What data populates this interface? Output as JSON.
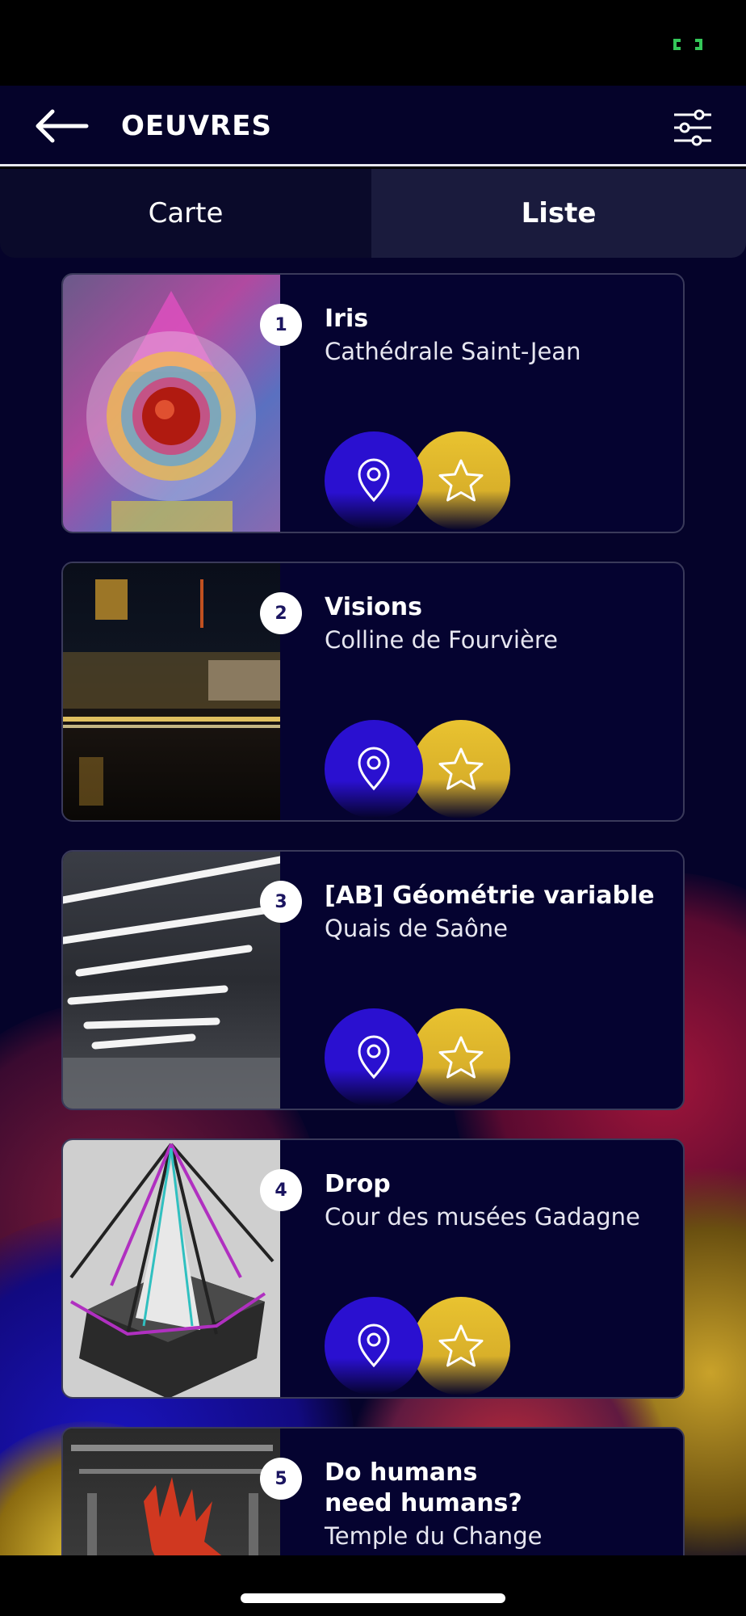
{
  "header": {
    "title": "OEUVRES"
  },
  "tabs": [
    {
      "label": "Carte",
      "active": false
    },
    {
      "label": "Liste",
      "active": true
    }
  ],
  "colors": {
    "background": "#05032a",
    "pin_button": "#2a10d0",
    "star_button": "#e9c330",
    "battery": "#34c759"
  },
  "icons": {
    "back": "arrow-left-icon",
    "filter": "sliders-icon",
    "location": "map-pin-icon",
    "favorite": "star-icon"
  },
  "artworks": [
    {
      "number": "1",
      "title": "Iris",
      "location": "Cathédrale Saint-Jean"
    },
    {
      "number": "2",
      "title": "Visions",
      "location": "Colline de Fourvière"
    },
    {
      "number": "3",
      "title": "[AB] Géométrie variable",
      "location": "Quais de Saône"
    },
    {
      "number": "4",
      "title": "Drop",
      "location": "Cour des musées Gadagne"
    },
    {
      "number": "5",
      "title": "Do humans need humans?",
      "location": "Temple du Change"
    }
  ]
}
